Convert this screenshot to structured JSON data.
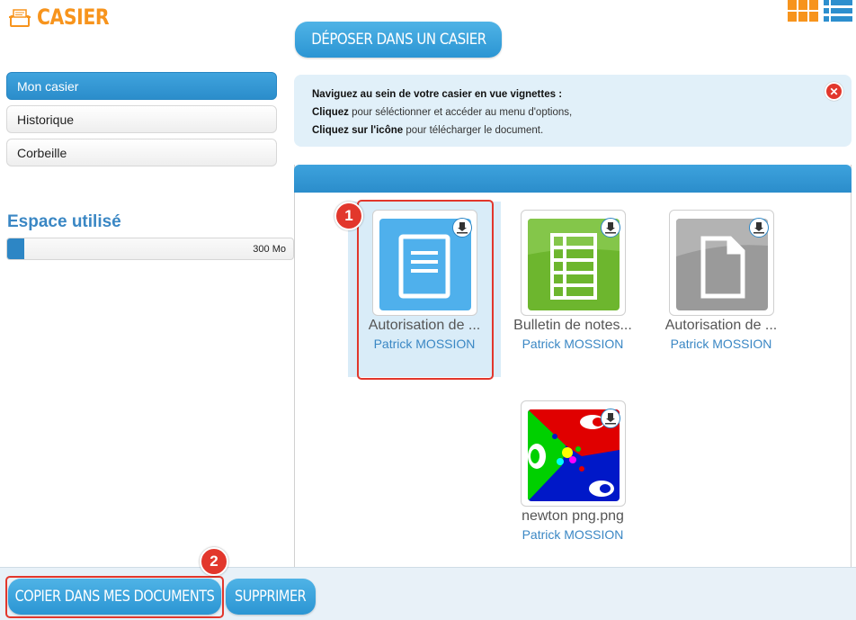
{
  "app": {
    "title": "CASIER"
  },
  "header": {
    "deposit_label": "DÉPOSER DANS UN CASIER"
  },
  "sidebar": {
    "items": [
      {
        "label": "Mon casier",
        "active": true
      },
      {
        "label": "Historique",
        "active": false
      },
      {
        "label": "Corbeille",
        "active": false
      }
    ],
    "space_title": "Espace utilisé",
    "space_value": "300 Mo",
    "space_used_fraction": 0.06
  },
  "info": {
    "line1": "Naviguez au sein de votre casier en vue vignettes :",
    "line2_bold": "Cliquez",
    "line2_rest": " pour séléctionner et accéder au menu d'options,",
    "line3_bold": "Cliquez sur l'icône",
    "line3_rest": " pour télécharger le document."
  },
  "files": [
    {
      "name": "Autorisation de ...",
      "owner": "Patrick MOSSION",
      "icon": "document-icon",
      "color": "#3d9fde"
    },
    {
      "name": "Bulletin de notes...",
      "owner": "Patrick MOSSION",
      "icon": "spreadsheet-icon",
      "color": "#6db62e"
    },
    {
      "name": "Autorisation de ...",
      "owner": "Patrick MOSSION",
      "icon": "generic-file-icon",
      "color": "#9a9a9a"
    },
    {
      "name": "newton png.png",
      "owner": "Patrick MOSSION",
      "icon": "image-thumbnail",
      "color": ""
    }
  ],
  "callouts": {
    "one": "1",
    "two": "2"
  },
  "actions": {
    "copy_label": "COPIER DANS MES DOCUMENTS",
    "delete_label": "SUPPRIMER"
  },
  "colors": {
    "accent": "#2b8dcb",
    "brand": "#f7941d",
    "alert": "#e2372c"
  }
}
